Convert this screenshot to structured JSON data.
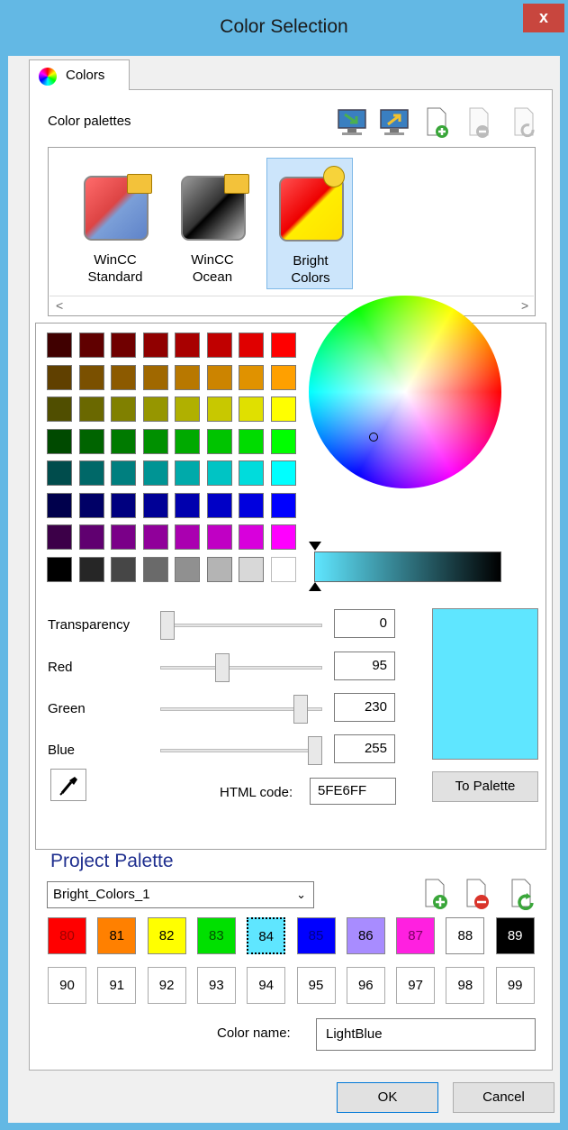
{
  "window": {
    "title": "Color Selection",
    "close_label": "x"
  },
  "tab": {
    "label": "Colors"
  },
  "palettes": {
    "label": "Color palettes",
    "items": [
      {
        "line1": "WinCC",
        "line2": "Standard",
        "locked": true
      },
      {
        "line1": "WinCC",
        "line2": "Ocean",
        "locked": true
      },
      {
        "line1": "Bright",
        "line2": "Colors",
        "locked": false,
        "selected": true
      }
    ],
    "scroll_left": "<",
    "scroll_right": ">"
  },
  "swatch_grid": [
    [
      "#400000",
      "#600000",
      "#700000",
      "#900000",
      "#a80000",
      "#c00000",
      "#e00000",
      "#ff0000"
    ],
    [
      "#604000",
      "#7a5000",
      "#8c5a00",
      "#a06800",
      "#b87800",
      "#cc8400",
      "#e09200",
      "#ffa000"
    ],
    [
      "#504e00",
      "#6a6800",
      "#808000",
      "#969600",
      "#b0b000",
      "#c8c800",
      "#e0e000",
      "#ffff00"
    ],
    [
      "#004a00",
      "#006400",
      "#007a00",
      "#009000",
      "#00aa00",
      "#00c400",
      "#00dc00",
      "#00ff00"
    ],
    [
      "#004c4c",
      "#006868",
      "#007f7f",
      "#009494",
      "#00aaaa",
      "#00c4c4",
      "#00dcdc",
      "#00ffff"
    ],
    [
      "#00004c",
      "#000066",
      "#00007f",
      "#000096",
      "#0000ae",
      "#0000c6",
      "#0000de",
      "#0000ff"
    ],
    [
      "#3c0048",
      "#600070",
      "#7a0088",
      "#90009a",
      "#aa00b0",
      "#c000c4",
      "#d800dc",
      "#ff00ff"
    ],
    [
      "#000000",
      "#262626",
      "#464646",
      "#6a6a6a",
      "#909090",
      "#b4b4b4",
      "#d8d8d8",
      "#ffffff"
    ]
  ],
  "sliders": {
    "transparency": {
      "label": "Transparency",
      "value": "0",
      "fraction": 0.0
    },
    "red": {
      "label": "Red",
      "value": "95",
      "fraction": 0.3725
    },
    "green": {
      "label": "Green",
      "value": "230",
      "fraction": 0.902
    },
    "blue": {
      "label": "Blue",
      "value": "255",
      "fraction": 1.0
    }
  },
  "current_color": "#5FE6FF",
  "html_code": {
    "label": "HTML code:",
    "value": "5FE6FF"
  },
  "to_palette_label": "To Palette",
  "project_palette": {
    "title": "Project Palette",
    "selected": "Bright_Colors_1",
    "row1": [
      {
        "label": "80",
        "color": "#ff0000",
        "text_color": "#a00000"
      },
      {
        "label": "81",
        "color": "#ff8000",
        "text_color": "#000000"
      },
      {
        "label": "82",
        "color": "#ffff00",
        "text_color": "#000000"
      },
      {
        "label": "83",
        "color": "#00e000",
        "text_color": "#005000"
      },
      {
        "label": "84",
        "color": "#5fe6ff",
        "text_color": "#000000",
        "selected": true
      },
      {
        "label": "85",
        "color": "#0000ff",
        "text_color": "#00008a"
      },
      {
        "label": "86",
        "color": "#a88cff",
        "text_color": "#000000"
      },
      {
        "label": "87",
        "color": "#ff20e0",
        "text_color": "#7a0060"
      },
      {
        "label": "88",
        "color": "#ffffff",
        "text_color": "#000000"
      },
      {
        "label": "89",
        "color": "#000000",
        "text_color": "#ffffff"
      }
    ],
    "row2": [
      "90",
      "91",
      "92",
      "93",
      "94",
      "95",
      "96",
      "97",
      "98",
      "99"
    ],
    "color_name_label": "Color name:",
    "color_name": "LightBlue"
  },
  "buttons": {
    "ok": "OK",
    "cancel": "Cancel"
  }
}
